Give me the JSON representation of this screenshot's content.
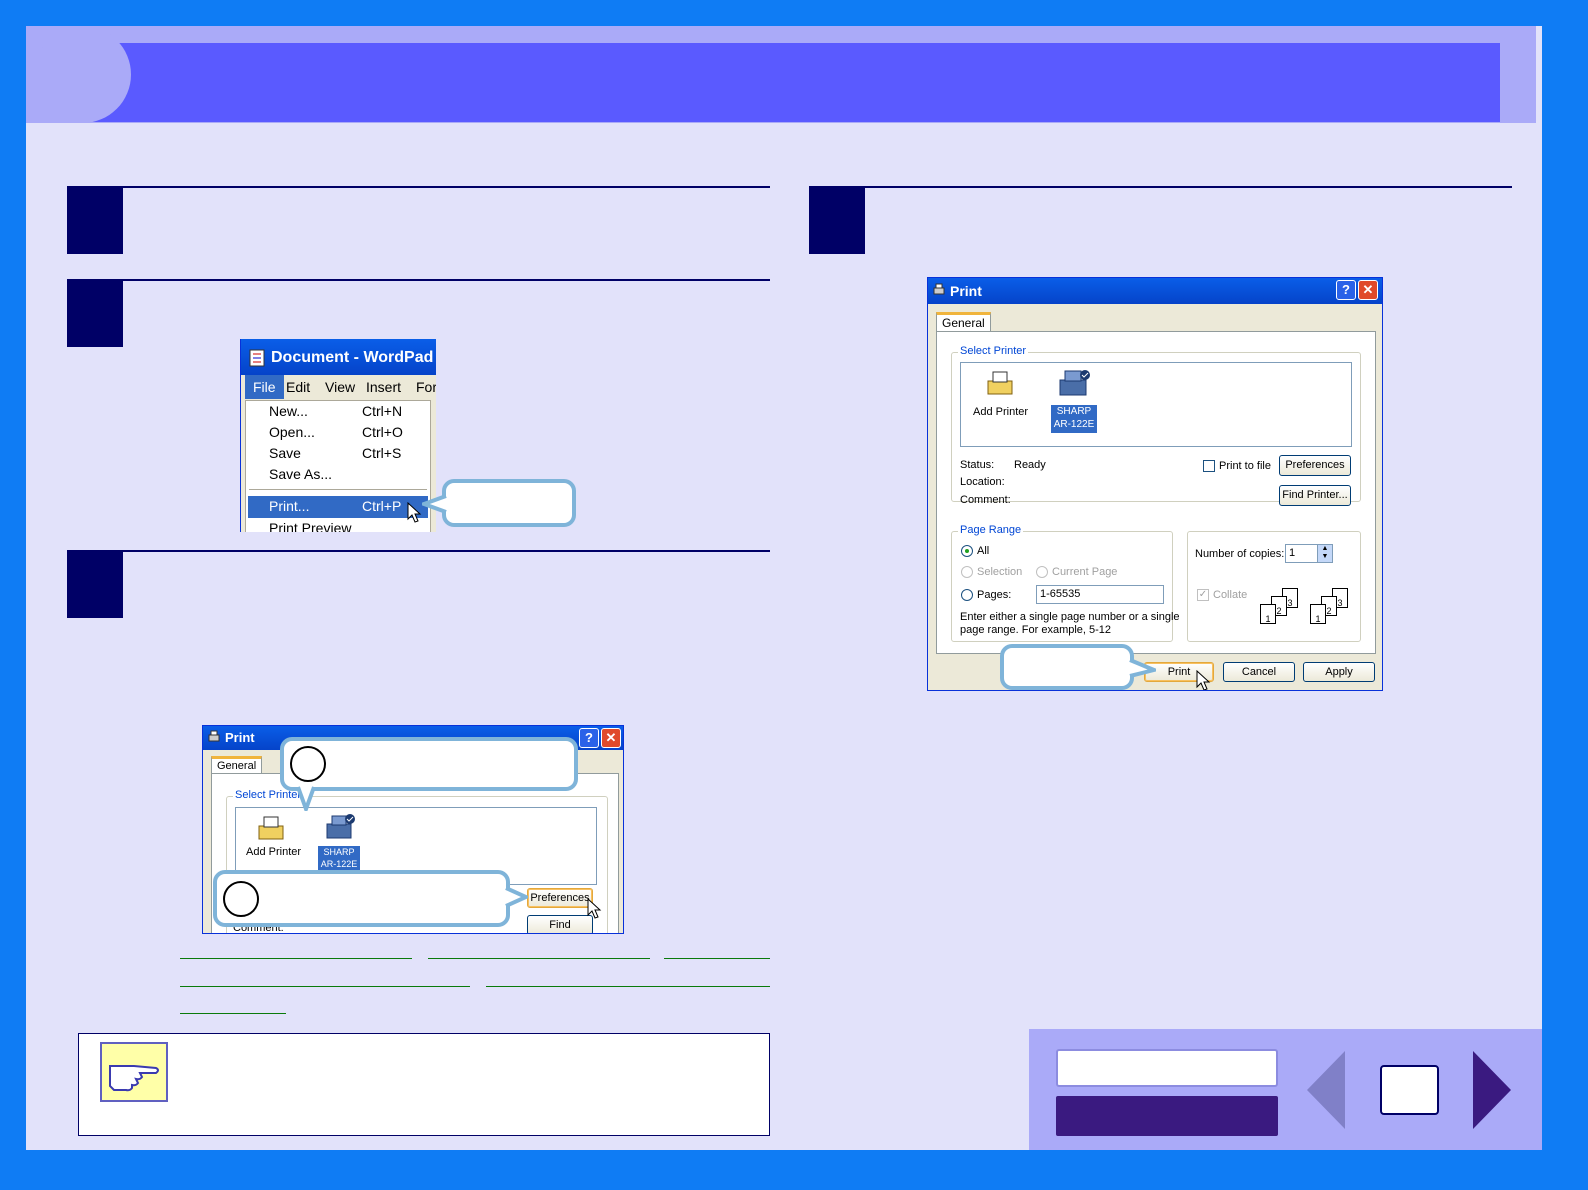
{
  "steps": {
    "step1_number": "",
    "step2_number": "",
    "step3_number": "",
    "step4_number": ""
  },
  "wordpad": {
    "title": "Document - WordPad",
    "menu": [
      "File",
      "Edit",
      "View",
      "Insert",
      "For"
    ],
    "items": [
      {
        "label": "New...",
        "shortcut": "Ctrl+N"
      },
      {
        "label": "Open...",
        "shortcut": "Ctrl+O"
      },
      {
        "label": "Save",
        "shortcut": "Ctrl+S"
      },
      {
        "label": "Save As...",
        "shortcut": ""
      },
      {
        "label": "Print...",
        "shortcut": "Ctrl+P"
      },
      {
        "label": "Print Preview",
        "shortcut": ""
      }
    ]
  },
  "small_print": {
    "title": "Print",
    "tab": "General",
    "select_printer": "Select Printer",
    "add_printer": "Add Printer",
    "printer_name_1": "SHARP",
    "printer_name_2": "AR-122E",
    "preferences": "Preferences",
    "find_printer": "Find Printer...",
    "comment_partial": "Comment:"
  },
  "large_print": {
    "title": "Print",
    "tab": "General",
    "select_printer": "Select Printer",
    "add_printer": "Add Printer",
    "printer_name_1": "SHARP",
    "printer_name_2": "AR-122E",
    "status_label": "Status:",
    "status_value": "Ready",
    "location_label": "Location:",
    "comment_label": "Comment:",
    "print_to_file": "Print to file",
    "preferences": "Preferences",
    "find_printer": "Find Printer...",
    "page_range": "Page Range",
    "all": "All",
    "selection": "Selection",
    "current_page": "Current Page",
    "pages": "Pages:",
    "pages_value": "1-65535",
    "hint_line1": "Enter either a single page number or a single",
    "hint_line2": "page range.  For example, 5-12",
    "copies_label": "Number of copies:",
    "copies_value": "1",
    "collate": "Collate",
    "print_btn": "Print",
    "cancel_btn": "Cancel",
    "apply_btn": "Apply"
  },
  "nav": {
    "contents_label": "",
    "index_label": "",
    "page_number": ""
  },
  "icons": {
    "note": "pointing-hand-icon"
  },
  "colors": {
    "frame": "#0f7cf4",
    "banner": "#5a5aff",
    "step_box": "#000066",
    "nav_panel": "#aaaaf8"
  }
}
